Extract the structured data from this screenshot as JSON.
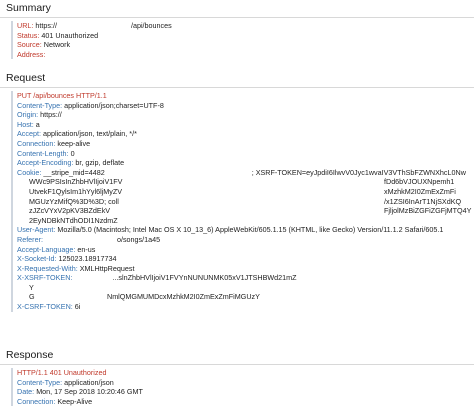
{
  "summary": {
    "title": "Summary",
    "url": {
      "key": "URL:",
      "value": "https://",
      "tail": "/api/bounces"
    },
    "status": {
      "key": "Status:",
      "value": "401 Unauthorized"
    },
    "source": {
      "key": "Source:",
      "value": "Network"
    },
    "address": {
      "key": "Address:",
      "value": ""
    }
  },
  "request": {
    "title": "Request",
    "line": "PUT /api/bounces HTTP/1.1",
    "headers": [
      {
        "key": "Content-Type:",
        "value": "application/json;charset=UTF-8"
      },
      {
        "key": "Origin:",
        "value": "https://"
      },
      {
        "key": "Host:",
        "value": "a"
      },
      {
        "key": "Accept:",
        "value": "application/json, text/plain, */*"
      },
      {
        "key": "Connection:",
        "value": "keep-alive"
      },
      {
        "key": "Content-Length:",
        "value": "0"
      },
      {
        "key": "Accept-Encoding:",
        "value": "br, gzip, deflate"
      }
    ],
    "cookie": {
      "key": "Cookie:",
      "value": "__stripe_mid=4482",
      "value_right": "; XSRF-TOKEN=eyJpdiI6IlwvV0Jyc1wvaIV3VThSbFZWNXhcL0Nw",
      "cont": [
        {
          "left": "WWc9PSIsInZhbHVlIjoiV1FV",
          "right": "fDd6bVJOUXNpemh1"
        },
        {
          "left": "UtvekF1QylsIm1hYyl6ljMyZV",
          "right": "xMzhkM2I0ZmExZmFi"
        },
        {
          "left": "MGUzYzMifQ%3D%3D; coll",
          "right": "/x1ZSI6InArT1NjSXdKQ"
        },
        {
          "left": "zJZcVYxV2pKV3BZdEkV",
          "right": "FjljolMzBiZGFiZGFjMTQ4Y"
        },
        {
          "left": "2EyNDBkNTdhODI1NzdmZ",
          "right": ""
        }
      ]
    },
    "headers2": [
      {
        "key": "User-Agent:",
        "value": "Mozilla/5.0 (Macintosh; Intel Mac OS X 10_13_6) AppleWebKit/605.1.15 (KHTML, like Gecko) Version/11.1.2 Safari/605.1"
      },
      {
        "key": "Referer:",
        "value": "",
        "tail": "o/songs/1a45"
      },
      {
        "key": "Accept-Language:",
        "value": "en-us"
      },
      {
        "key": "X-Socket-Id:",
        "value": "125023.18917734"
      },
      {
        "key": "X-Requested-With:",
        "value": "XMLHttpRequest"
      },
      {
        "key": "X-XSRF-TOKEN:",
        "value": "",
        "tail": "...slnZhbHVlIjoiV1FVYnNUNUNMK05xV1JTSHBWd21mZ"
      }
    ],
    "xsrf_cont": [
      {
        "left": "Y",
        "right": ""
      },
      {
        "left": "G",
        "right": "NmlQMGMUMDcxMzhkM2I0ZmExZmFiMGUzY"
      }
    ],
    "csrf": {
      "key": "X-CSRF-TOKEN:",
      "value": "6i"
    }
  },
  "response": {
    "title": "Response",
    "line": "HTTP/1.1 401 Unauthorized",
    "headers": [
      {
        "key": "Content-Type:",
        "value": "application/json"
      },
      {
        "key": "Date:",
        "value": "Mon, 17 Sep 2018 10:20:46 GMT"
      },
      {
        "key": "Connection:",
        "value": "Keep-Alive"
      }
    ]
  }
}
